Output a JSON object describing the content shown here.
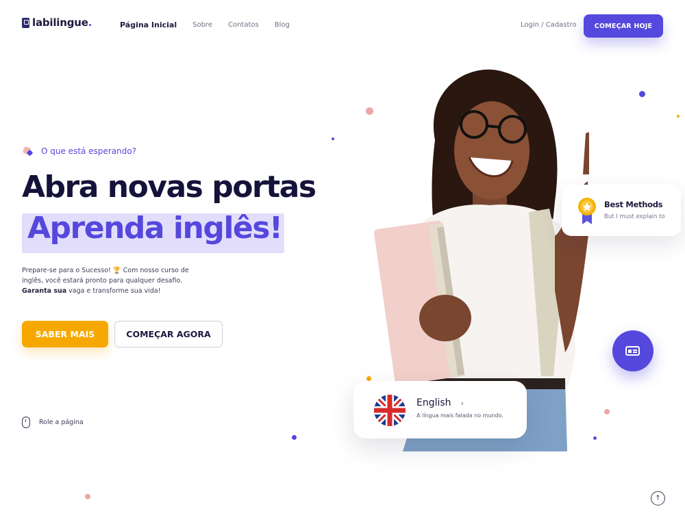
{
  "nav": {
    "brand": "labilingue",
    "brand_dot": ".",
    "menu": [
      "Página Inicial",
      "Sobre",
      "Contatos",
      "Blog"
    ],
    "login": "Login / Cadastro",
    "cta": "COMEÇAR HOJE"
  },
  "hero": {
    "eyebrow": "O que está esperando?",
    "title": "Abra novas portas",
    "highlight": "Aprenda inglês!",
    "desc_part1": "Prepare-se para o Sucesso! 🏆 Com nosso curso de inglês, você estará pronto para qualquer desafio. ",
    "desc_bold": "Garanta sua",
    "desc_part2": " vaga e transforme sua vida!",
    "btn_more": "SABER MAIS",
    "btn_now": "COMEÇAR AGORA",
    "scroll": "Role a página"
  },
  "cards": {
    "best_title": "Best Methods",
    "best_sub": "But I must explain to",
    "lang_title": "English",
    "lang_sub": "A língua mais falada no mundo."
  },
  "icons": {
    "logo": "book-icon",
    "mouse": "mouse-icon",
    "medal": "medal-icon",
    "fab": "id-card-icon",
    "flag": "uk-flag-icon",
    "chevron": "chevron-right-icon",
    "top": "arrow-up-icon"
  },
  "colors": {
    "primary": "#5548dd",
    "accent": "#f7a800",
    "dark": "#15133a",
    "highlight_bg": "#e2ddfb"
  }
}
